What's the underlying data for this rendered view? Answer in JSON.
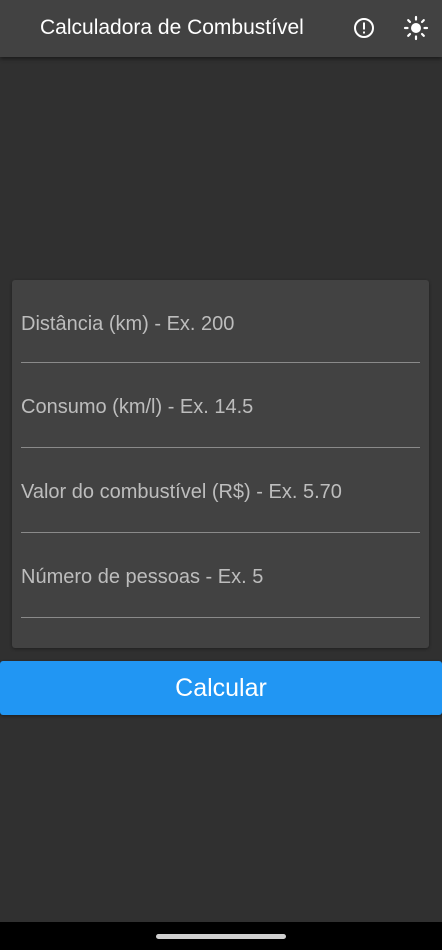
{
  "app_bar": {
    "title": "Calculadora de Combustível",
    "actions": [
      {
        "icon": "info-icon"
      },
      {
        "icon": "brightness-icon"
      }
    ]
  },
  "form": {
    "fields": [
      {
        "placeholder": "Distância (km) - Ex. 200",
        "value": ""
      },
      {
        "placeholder": "Consumo (km/l) - Ex. 14.5",
        "value": ""
      },
      {
        "placeholder": "Valor do combustível (R$) - Ex. 5.70",
        "value": ""
      },
      {
        "placeholder": "Número de pessoas - Ex. 5",
        "value": ""
      }
    ]
  },
  "calculate_button": {
    "label": "Calcular"
  },
  "colors": {
    "background": "#303030",
    "surface": "#424242",
    "accent": "#2196f3",
    "text": "#ffffff",
    "hint": "#bdbdbd"
  }
}
